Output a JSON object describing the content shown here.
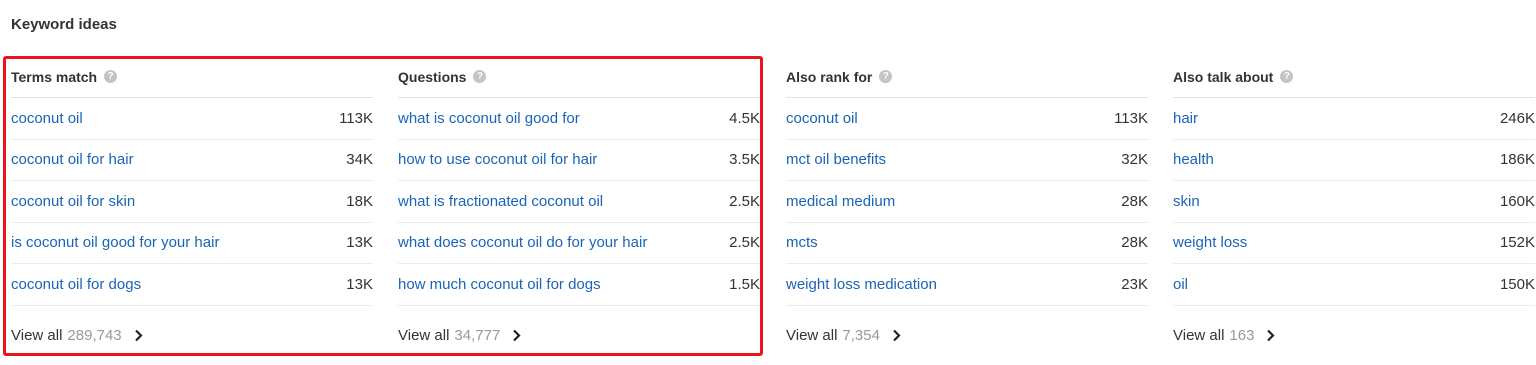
{
  "section_title": "Keyword ideas",
  "columns": [
    {
      "title": "Terms match",
      "rows": [
        {
          "keyword": "coconut oil",
          "volume": "113K"
        },
        {
          "keyword": "coconut oil for hair",
          "volume": "34K"
        },
        {
          "keyword": "coconut oil for skin",
          "volume": "18K"
        },
        {
          "keyword": "is coconut oil good for your hair",
          "volume": "13K"
        },
        {
          "keyword": "coconut oil for dogs",
          "volume": "13K"
        }
      ],
      "view_all_label": "View all",
      "view_all_count": "289,743"
    },
    {
      "title": "Questions",
      "rows": [
        {
          "keyword": "what is coconut oil good for",
          "volume": "4.5K"
        },
        {
          "keyword": "how to use coconut oil for hair",
          "volume": "3.5K"
        },
        {
          "keyword": "what is fractionated coconut oil",
          "volume": "2.5K"
        },
        {
          "keyword": "what does coconut oil do for your hair",
          "volume": "2.5K"
        },
        {
          "keyword": "how much coconut oil for dogs",
          "volume": "1.5K"
        }
      ],
      "view_all_label": "View all",
      "view_all_count": "34,777"
    },
    {
      "title": "Also rank for",
      "rows": [
        {
          "keyword": "coconut oil",
          "volume": "113K"
        },
        {
          "keyword": "mct oil benefits",
          "volume": "32K"
        },
        {
          "keyword": "medical medium",
          "volume": "28K"
        },
        {
          "keyword": "mcts",
          "volume": "28K"
        },
        {
          "keyword": "weight loss medication",
          "volume": "23K"
        }
      ],
      "view_all_label": "View all",
      "view_all_count": "7,354"
    },
    {
      "title": "Also talk about",
      "rows": [
        {
          "keyword": "hair",
          "volume": "246K"
        },
        {
          "keyword": "health",
          "volume": "186K"
        },
        {
          "keyword": "skin",
          "volume": "160K"
        },
        {
          "keyword": "weight loss",
          "volume": "152K"
        },
        {
          "keyword": "oil",
          "volume": "150K"
        }
      ],
      "view_all_label": "View all",
      "view_all_count": "163"
    }
  ],
  "help_icon": "question-circle-icon",
  "chevron_icon": "chevron-right-icon",
  "colors": {
    "link": "#1a64b5",
    "highlight": "#e8131b",
    "muted": "#999999"
  }
}
